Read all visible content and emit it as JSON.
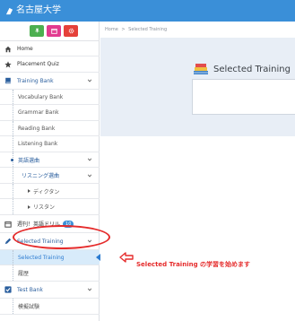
{
  "header": {
    "logo_text": "名古屋大学",
    "brand_color": "#3a8fd8"
  },
  "sidebar": {
    "action_buttons": [
      {
        "icon": "pin-icon",
        "color": "#4caf50"
      },
      {
        "icon": "calendar-icon",
        "color": "#e23a8f"
      },
      {
        "icon": "gear-icon",
        "color": "#e5413a"
      }
    ],
    "items": [
      {
        "label": "Home",
        "icon": "home-icon"
      },
      {
        "label": "Placement Quiz",
        "icon": "star-icon"
      },
      {
        "label": "Training Bank",
        "icon": "book-icon"
      },
      {
        "label": "Vocabulary Bank"
      },
      {
        "label": "Grammar Bank"
      },
      {
        "label": "Reading Bank"
      },
      {
        "label": "Listening Bank"
      },
      {
        "label": "英語選曲"
      },
      {
        "label": "リスニング選曲"
      },
      {
        "label": "ディクタン"
      },
      {
        "label": "リスタン"
      },
      {
        "label": "週刊！英語ドリル",
        "badge": "10",
        "icon": "calendar-icon"
      },
      {
        "label": "Selected Training",
        "icon": "pencil-icon"
      },
      {
        "label": "Selected Training"
      },
      {
        "label": "履歴"
      },
      {
        "label": "Test Bank",
        "icon": "check-icon"
      },
      {
        "label": "模擬試験"
      }
    ]
  },
  "breadcrumb": {
    "home": "Home",
    "separator": ">",
    "current": "Selected Training"
  },
  "main": {
    "heading": "Selected Training"
  },
  "annotation": {
    "text": "Selected Training の学習を始めます",
    "color": "#e52b2b"
  }
}
